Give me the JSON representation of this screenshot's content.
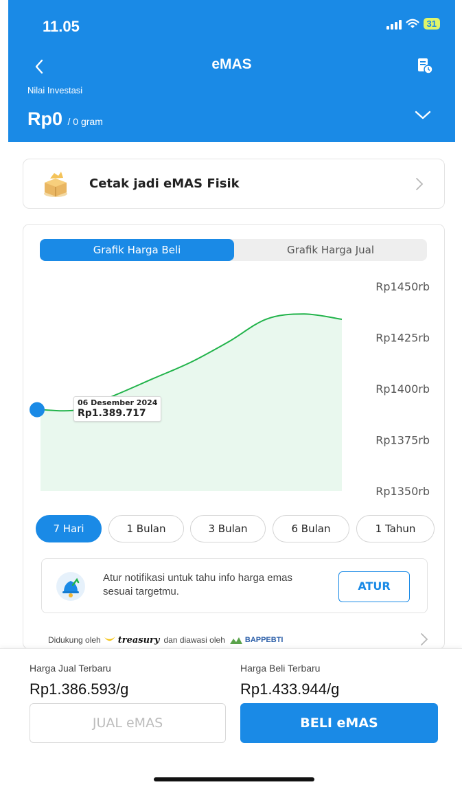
{
  "status_bar": {
    "time": "11.05",
    "battery": "31"
  },
  "header": {
    "title": "eMAS",
    "investment_label": "Nilai Investasi",
    "investment_value": "Rp0",
    "investment_gram": "/ 0 gram"
  },
  "cetak": {
    "label": "Cetak jadi eMAS Fisik"
  },
  "chart_tabs": [
    {
      "label": "Grafik Harga Beli",
      "active": true
    },
    {
      "label": "Grafik Harga Jual",
      "active": false
    }
  ],
  "tooltip": {
    "date": "06 Desember 2024",
    "value": "Rp1.389.717"
  },
  "ranges": [
    {
      "label": "7 Hari",
      "active": true
    },
    {
      "label": "1 Bulan",
      "active": false
    },
    {
      "label": "3 Bulan",
      "active": false
    },
    {
      "label": "6 Bulan",
      "active": false
    },
    {
      "label": "1 Tahun",
      "active": false
    }
  ],
  "notification": {
    "text": "Atur notifikasi untuk tahu info harga emas sesuai targetmu.",
    "button": "ATUR"
  },
  "support": {
    "prefix": "Didukung oleh",
    "partner": "treasury",
    "middle": "dan diawasi oleh",
    "regulator": "BAPPEBTI"
  },
  "bottom": {
    "sell_label": "Harga Jual Terbaru",
    "sell_value": "Rp1.386.593/g",
    "buy_label": "Harga Beli Terbaru",
    "buy_value": "Rp1.433.944/g",
    "sell_button": "JUAL eMAS",
    "buy_button": "BELI eMAS"
  },
  "colors": {
    "primary": "#1a8ae6",
    "line": "#21b34a",
    "fill": "#e9f8ee"
  },
  "chart_data": {
    "type": "area",
    "y_tick_labels": [
      "Rp1450rb",
      "Rp1425rb",
      "Rp1400rb",
      "Rp1375rb",
      "Rp1350rb"
    ],
    "y_ticks": [
      1450,
      1425,
      1400,
      1375,
      1350
    ],
    "ylim": [
      1350,
      1450
    ],
    "series": [
      {
        "values": [
          1389.717,
          1389.717,
          1397,
          1405,
          1413,
          1423,
          1434,
          1436.5,
          1433.9
        ]
      }
    ],
    "grid": false
  }
}
